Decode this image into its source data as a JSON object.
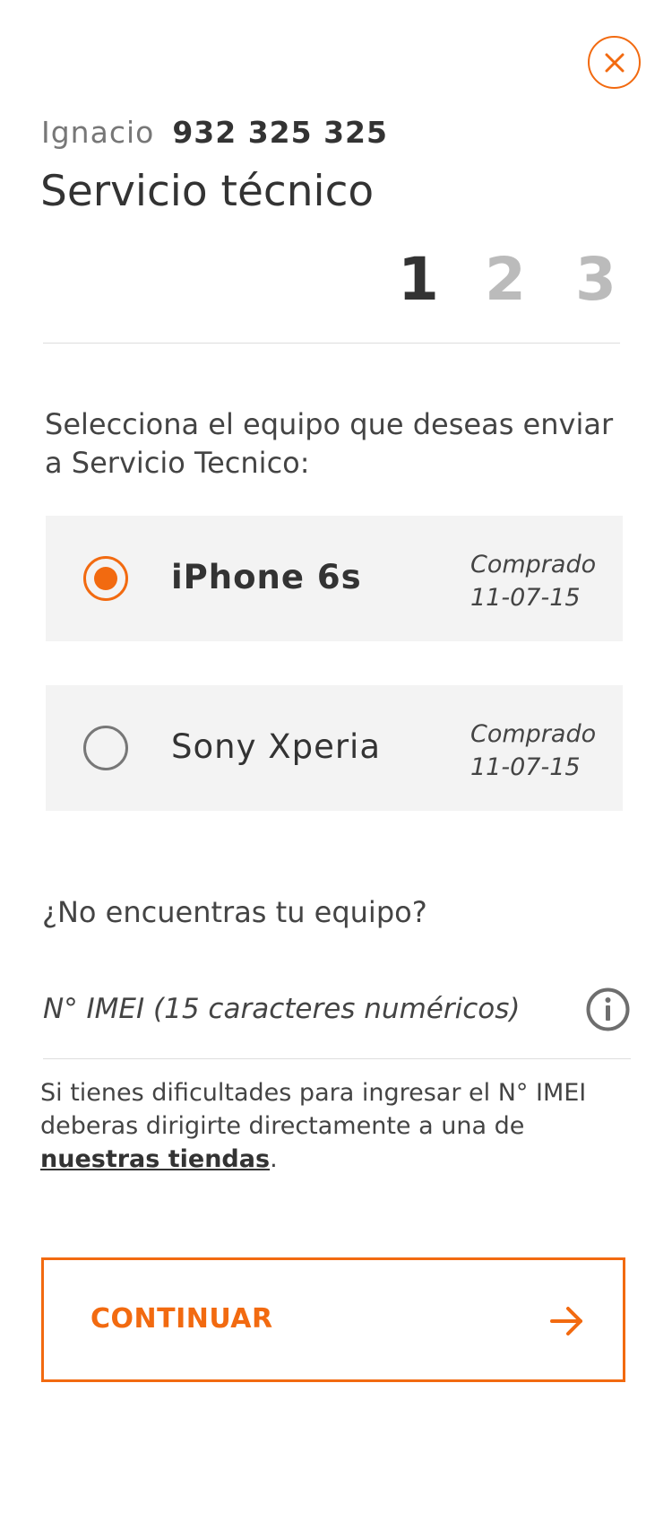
{
  "header": {
    "user_name": "Ignacio",
    "phone_number": "932 325 325",
    "title": "Servicio técnico"
  },
  "stepper": {
    "steps": [
      "1",
      "2",
      "3"
    ],
    "active_step": 1
  },
  "instruction": "Selecciona el equipo que deseas enviar a Servicio Tecnico:",
  "devices": [
    {
      "name": "iPhone 6s",
      "purchased_label": "Comprado",
      "purchased_date": "11-07-15",
      "selected": true
    },
    {
      "name": "Sony Xperia",
      "purchased_label": "Comprado",
      "purchased_date": "11-07-15",
      "selected": false
    }
  ],
  "not_found": {
    "question": "¿No encuentras tu equipo?",
    "imei_placeholder": "N° IMEI (15 caracteres numéricos)",
    "imei_value": ""
  },
  "help": {
    "text": "Si tienes dificultades para ingresar el N° IMEI deberas dirigirte directamente a una de ",
    "link": "nuestras tiendas",
    "end": "."
  },
  "actions": {
    "continue_label": "CONTINUAR"
  },
  "icons": {
    "close": "close-icon",
    "info": "info-icon",
    "arrow": "arrow-right-icon"
  },
  "colors": {
    "accent": "#f26a10",
    "text_dark": "#333333",
    "text_muted": "#777777",
    "step_inactive": "#bbbbbb",
    "card_bg": "#f3f3f3"
  }
}
